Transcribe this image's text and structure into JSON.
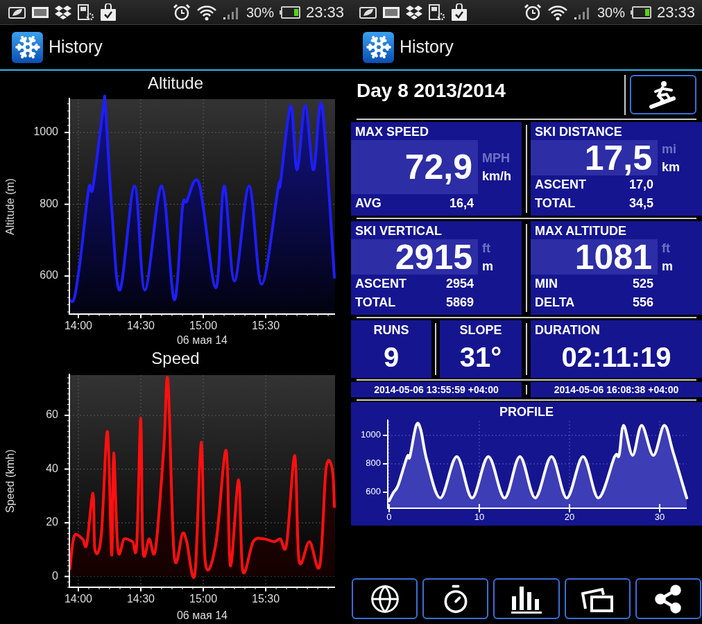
{
  "left_screen": {
    "status_bar": {
      "battery": "30%",
      "time": "23:33"
    },
    "app_bar": {
      "title": "History"
    },
    "charts": [
      {
        "chart_data": {
          "type": "area",
          "title": "Altitude",
          "xlabel": "06 мая 14",
          "ylabel": "Altitude (m)",
          "x": [
            13.933,
            13.967,
            14.012,
            14.083,
            14.117,
            14.2,
            14.217,
            14.267,
            14.333,
            14.45,
            14.533,
            14.667,
            14.767,
            14.833,
            14.867,
            14.967,
            15.1,
            15.167,
            15.25,
            15.367,
            15.467,
            15.6,
            15.617,
            15.7,
            15.75,
            15.817,
            15.883,
            15.95,
            16.05
          ],
          "series": [
            {
              "color": "#1e1eff",
              "values": [
                532,
                538,
                635,
                843,
                847,
                1070,
                1070,
                790,
                561,
                851,
                561,
                851,
                534,
                790,
                808,
                857,
                567,
                851,
                586,
                851,
                577,
                847,
                857,
                1075,
                896,
                1075,
                896,
                1075,
                596
              ]
            }
          ],
          "grid": true,
          "xlim": [
            13.928,
            16.055
          ],
          "ylim": [
            494,
            1093
          ],
          "xticks": [
            {
              "value": 14,
              "label": "14:00"
            },
            {
              "value": 14.5,
              "label": "14:30"
            },
            {
              "value": 15,
              "label": "15:00"
            },
            {
              "value": 15.5,
              "label": "15:30"
            }
          ],
          "yticks": [
            600,
            800,
            1000
          ]
        }
      },
      {
        "chart_data": {
          "type": "area",
          "title": "Speed",
          "xlabel": "06 мая 14",
          "ylabel": "Speed (kmh)",
          "x": [
            13.933,
            13.967,
            14.033,
            14.067,
            14.117,
            14.133,
            14.183,
            14.233,
            14.267,
            14.283,
            14.317,
            14.367,
            14.433,
            14.467,
            14.5,
            14.517,
            14.567,
            14.617,
            14.683,
            14.717,
            14.767,
            14.833,
            14.867,
            14.933,
            14.983,
            15.017,
            15.1,
            15.183,
            15.217,
            15.283,
            15.317,
            15.4,
            15.483,
            15.567,
            15.617,
            15.667,
            15.733,
            15.767,
            15.85,
            15.933,
            15.983,
            16.033,
            16.05
          ],
          "series": [
            {
              "color": "#ff1010",
              "values": [
                3,
                15,
                14,
                12,
                31,
                10,
                15,
                54,
                8,
                46,
                10,
                14,
                13,
                12,
                59,
                10,
                14,
                10,
                47,
                73,
                8,
                16,
                13,
                1,
                50,
                5,
                12,
                47,
                4,
                36,
                2,
                13,
                14,
                13,
                14,
                12,
                45,
                6,
                13,
                4,
                40,
                40,
                26
              ]
            }
          ],
          "grid": true,
          "xlim": [
            13.928,
            16.055
          ],
          "ylim": [
            -4,
            75
          ],
          "xticks": [
            {
              "value": 14,
              "label": "14:00"
            },
            {
              "value": 14.5,
              "label": "14:30"
            },
            {
              "value": 15,
              "label": "15:00"
            },
            {
              "value": 15.5,
              "label": "15:30"
            }
          ],
          "yticks": [
            0,
            20,
            40,
            60
          ]
        }
      }
    ]
  },
  "right_screen": {
    "status_bar": {
      "battery": "30%",
      "time": "23:33"
    },
    "app_bar": {
      "title": "History"
    },
    "day_title": "Day 8 2013/2014",
    "stat_tiles": [
      {
        "label": "MAX SPEED",
        "value": "72,9",
        "units": [
          {
            "text": "MPH",
            "selected": false
          },
          {
            "text": "km/h",
            "selected": true
          }
        ],
        "rows": [
          {
            "label": "AVG",
            "value": "16,4"
          }
        ]
      },
      {
        "label": "SKI DISTANCE",
        "value": "17,5",
        "units": [
          {
            "text": "mi",
            "selected": false
          },
          {
            "text": "km",
            "selected": true
          }
        ],
        "rows": [
          {
            "label": "ASCENT",
            "value": "17,0"
          },
          {
            "label": "TOTAL",
            "value": "34,5"
          }
        ]
      },
      {
        "label": "SKI VERTICAL",
        "value": "2915",
        "units": [
          {
            "text": "ft",
            "selected": false
          },
          {
            "text": "m",
            "selected": true
          }
        ],
        "rows": [
          {
            "label": "ASCENT",
            "value": "2954"
          },
          {
            "label": "TOTAL",
            "value": "5869"
          }
        ]
      },
      {
        "label": "MAX ALTITUDE",
        "value": "1081",
        "units": [
          {
            "text": "ft",
            "selected": false
          },
          {
            "text": "m",
            "selected": true
          }
        ],
        "rows": [
          {
            "label": "MIN",
            "value": "525"
          },
          {
            "label": "DELTA",
            "value": "556"
          }
        ]
      }
    ],
    "small_tiles": [
      {
        "label": "RUNS",
        "value": "9"
      },
      {
        "label": "SLOPE",
        "value": "31°"
      },
      {
        "label": "DURATION",
        "value": "02:11:19"
      }
    ],
    "time_range": [
      "2014-05-06 13:55:59 +04:00",
      "2014-05-06 16:08:38 +04:00"
    ],
    "profile": {
      "chart_data": {
        "type": "area",
        "title": "PROFILE",
        "x": [
          0,
          0.5,
          1,
          2,
          2.3,
          3,
          3.5,
          4.2,
          5.7,
          7.5,
          9.2,
          11,
          12.8,
          14.5,
          16.2,
          18,
          19.7,
          21.5,
          23.2,
          25,
          25.5,
          26,
          27,
          28,
          29.3,
          30.5,
          31.5,
          33
        ],
        "series": [
          {
            "color": "#ffffff",
            "values": [
              540,
              600,
              650,
              850,
              850,
              1070,
              1040,
              820,
              560,
              851,
              560,
              851,
              560,
              851,
              560,
              851,
              560,
              851,
              560,
              850,
              860,
              1070,
              860,
              1070,
              860,
              1070,
              880,
              560
            ]
          }
        ],
        "grid": true,
        "xlim": [
          -0.15,
          33
        ],
        "ylim": [
          488,
          1102
        ],
        "xticks": [
          0,
          10,
          20,
          30
        ],
        "yticks": [
          600,
          800,
          1000
        ]
      }
    },
    "bottom_buttons": [
      {
        "kind": "globe"
      },
      {
        "kind": "stopwatch"
      },
      {
        "kind": "bars"
      },
      {
        "kind": "photos"
      },
      {
        "kind": "share"
      }
    ]
  }
}
